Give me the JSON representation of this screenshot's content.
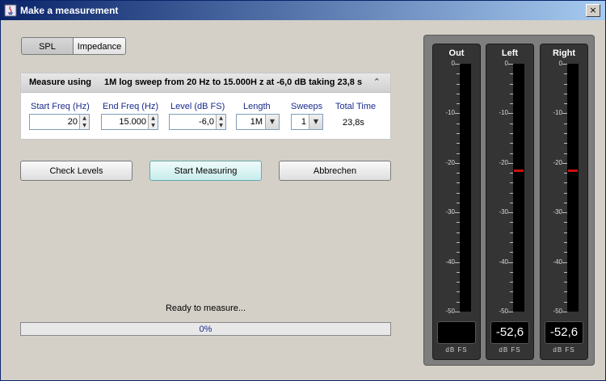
{
  "window": {
    "title": "Make a measurement",
    "close": "×"
  },
  "mode_tabs": [
    {
      "label": "SPL",
      "selected": true
    },
    {
      "label": "Impedance",
      "selected": false
    }
  ],
  "measure_panel": {
    "label": "Measure using",
    "description": "1M log sweep from 20 Hz to 15.000H z at -6,0 dB taking 23,8 s",
    "fields": {
      "start_freq": {
        "label": "Start Freq (Hz)",
        "value": "20"
      },
      "end_freq": {
        "label": "End Freq (Hz)",
        "value": "15.000"
      },
      "level": {
        "label": "Level (dB FS)",
        "value": "-6,0"
      },
      "length": {
        "label": "Length",
        "value": "1M"
      },
      "sweeps": {
        "label": "Sweeps",
        "value": "1"
      },
      "total_time": {
        "label": "Total Time",
        "value": "23,8s"
      }
    }
  },
  "buttons": {
    "check_levels": "Check Levels",
    "start_measuring": "Start Measuring",
    "cancel": "Abbrechen"
  },
  "status": {
    "text": "Ready to measure...",
    "progress_text": "0%",
    "progress_fraction": 0
  },
  "meters": {
    "scale_labels": [
      "0",
      "-10",
      "-20",
      "-30",
      "-40",
      "-50"
    ],
    "scale_min": -50,
    "scale_max": 0,
    "unit": "dB FS",
    "peak_color": "#cc1010",
    "channels": [
      {
        "name": "Out",
        "reading": "",
        "peak": null
      },
      {
        "name": "Left",
        "reading": "-52,6",
        "peak": -21.5
      },
      {
        "name": "Right",
        "reading": "-52,6",
        "peak": -21.5
      }
    ]
  }
}
